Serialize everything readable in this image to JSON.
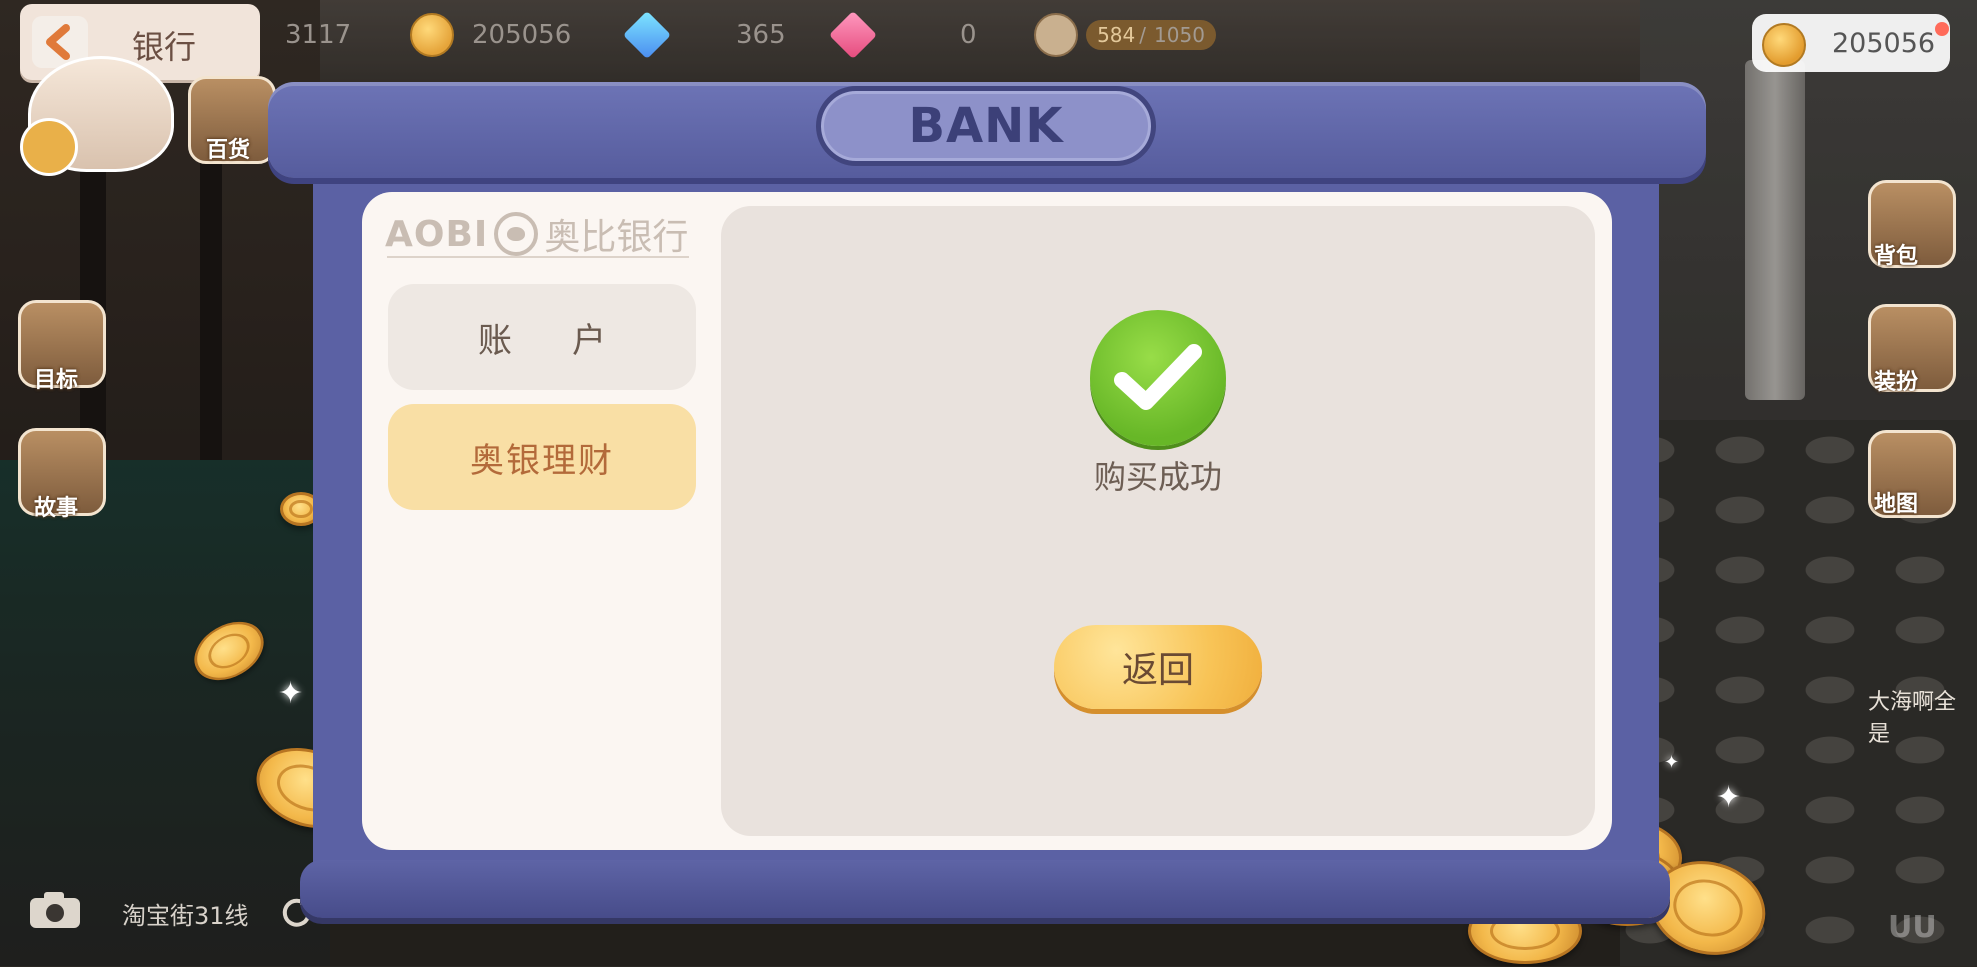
{
  "header": {
    "back_label": "银行"
  },
  "hud": {
    "stat_1": "3117",
    "coins": "205056",
    "diamonds": "365",
    "pink_gems": "0",
    "energy_current": "584",
    "energy_max": "1050"
  },
  "gold_display": {
    "value": "205056"
  },
  "side_menu": {
    "left": [
      "百货",
      "目标",
      "故事"
    ],
    "right": [
      "背包",
      "装扮",
      "地图"
    ]
  },
  "bottom": {
    "line": "淘宝街31线",
    "player_name": "大海啊全是"
  },
  "dialog": {
    "title": "BANK",
    "logo_en": "AOBI",
    "logo_cn": "奥比银行",
    "tabs": [
      {
        "label": "账户",
        "active": false
      },
      {
        "label": "奥银理财",
        "active": true
      }
    ],
    "result": {
      "message": "购买成功",
      "button": "返回"
    }
  },
  "colors": {
    "frame": "#5b61a4",
    "panel": "#fbf6f2",
    "active_tab": "#f9dfa5",
    "success": "#7cc537",
    "button": "#f8c457"
  }
}
